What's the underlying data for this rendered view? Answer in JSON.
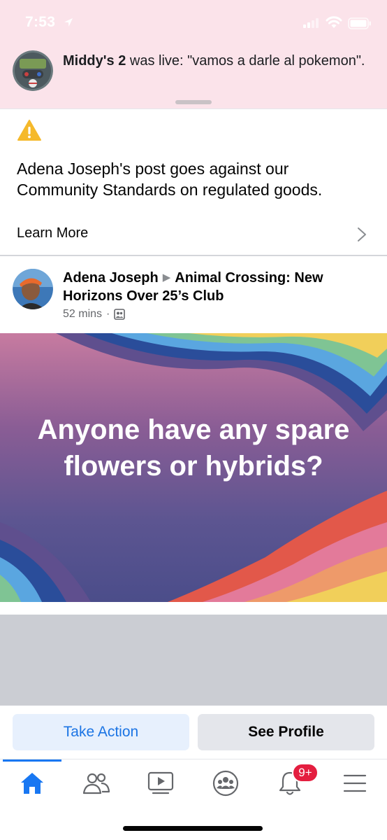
{
  "status_bar": {
    "time": "7:53"
  },
  "notification": {
    "page_name": "Middy's 2",
    "text": " was live: \"vamos a darle al pokemon\"."
  },
  "warning": {
    "message": "Adena Joseph's post goes against our Community Standards on regulated goods.",
    "learn_more_label": "Learn More"
  },
  "post": {
    "author": "Adena Joseph",
    "group": "Animal Crossing: New Horizons Over 25’s Club",
    "time_ago": "52 mins",
    "separator": "·",
    "text": "Anyone have any spare flowers or hybrids?"
  },
  "actions": {
    "take_action_label": "Take Action",
    "see_profile_label": "See Profile"
  },
  "tabbar": {
    "notifications_badge": "9+",
    "icons": [
      "home-icon",
      "friends-icon",
      "watch-icon",
      "groups-icon",
      "notifications-icon",
      "menu-icon"
    ]
  },
  "colors": {
    "accent": "#1877f2",
    "banner_bg": "#fbe3ea",
    "warning": "#f5b92b",
    "badge": "#e41e3f"
  }
}
